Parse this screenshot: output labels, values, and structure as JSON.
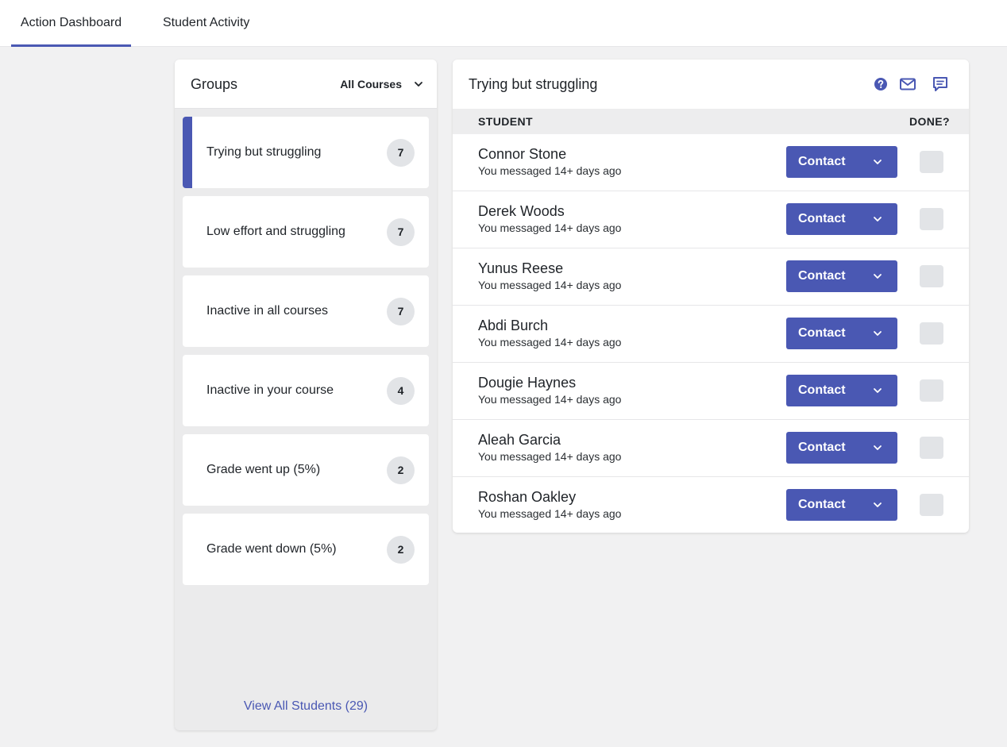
{
  "nav": {
    "tabs": [
      {
        "label": "Action Dashboard",
        "active": true
      },
      {
        "label": "Student Activity",
        "active": false
      }
    ]
  },
  "groups": {
    "title": "Groups",
    "course_filter": "All Courses",
    "items": [
      {
        "label": "Trying but struggling",
        "count": "7",
        "selected": true
      },
      {
        "label": "Low effort and struggling",
        "count": "7"
      },
      {
        "label": "Inactive in all courses",
        "count": "7"
      },
      {
        "label": "Inactive in your course",
        "count": "4"
      },
      {
        "label": "Grade went up (5%)",
        "count": "2"
      },
      {
        "label": "Grade went down (5%)",
        "count": "2"
      }
    ],
    "view_all": "View All Students (29)"
  },
  "students": {
    "title": "Trying but struggling",
    "columns": {
      "student": "STUDENT",
      "done": "DONE?"
    },
    "contact_label": "Contact",
    "rows": [
      {
        "name": "Connor Stone",
        "status": "You messaged 14+ days ago"
      },
      {
        "name": "Derek Woods",
        "status": "You messaged 14+ days ago"
      },
      {
        "name": "Yunus Reese",
        "status": "You messaged 14+ days ago"
      },
      {
        "name": "Abdi Burch",
        "status": "You messaged 14+ days ago"
      },
      {
        "name": "Dougie Haynes",
        "status": "You messaged 14+ days ago"
      },
      {
        "name": "Aleah Garcia",
        "status": "You messaged 14+ days ago"
      },
      {
        "name": "Roshan Oakley",
        "status": "You messaged 14+ days ago"
      }
    ]
  },
  "colors": {
    "accent": "#4a58b3",
    "background": "#f1f1f2",
    "badge": "#e2e4e7"
  },
  "icons": {
    "help": "help-circle-icon",
    "mail": "mail-icon",
    "chat": "chat-icon",
    "dropdown": "chevron-down-icon"
  }
}
